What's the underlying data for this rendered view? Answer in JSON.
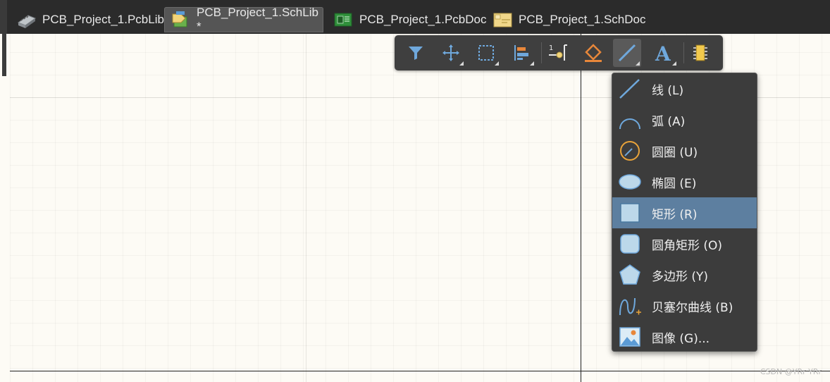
{
  "tabs": [
    {
      "label": "PCB_Project_1.PcbLib",
      "icon": "pcblib-icon",
      "active": false
    },
    {
      "label": "PCB_Project_1.SchLib *",
      "icon": "schlib-icon",
      "active": true
    },
    {
      "label": "PCB_Project_1.PcbDoc",
      "icon": "pcbdoc-icon",
      "active": false
    },
    {
      "label": "PCB_Project_1.SchDoc",
      "icon": "schdoc-icon",
      "active": false
    }
  ],
  "toolbar": {
    "buttons": [
      {
        "name": "filter-icon"
      },
      {
        "name": "move-icon"
      },
      {
        "name": "select-icon"
      },
      {
        "name": "align-icon"
      },
      {
        "name": "pin-icon"
      },
      {
        "name": "fill-icon"
      },
      {
        "name": "line-tool-icon",
        "active": true
      },
      {
        "name": "text-icon"
      },
      {
        "name": "component-icon"
      }
    ]
  },
  "menu": {
    "items": [
      {
        "label": "线 (L)",
        "icon": "line-icon"
      },
      {
        "label": "弧 (A)",
        "icon": "arc-icon"
      },
      {
        "label": "圆圈 (U)",
        "icon": "circle-icon"
      },
      {
        "label": "椭圆 (E)",
        "icon": "ellipse-icon"
      },
      {
        "label": "矩形 (R)",
        "icon": "rectangle-icon",
        "selected": true
      },
      {
        "label": "圆角矩形 (O)",
        "icon": "round-rectangle-icon"
      },
      {
        "label": "多边形 (Y)",
        "icon": "polygon-icon"
      },
      {
        "label": "贝塞尔曲线 (B)",
        "icon": "bezier-icon"
      },
      {
        "label": "图像 (G)...",
        "icon": "image-icon"
      }
    ]
  },
  "colors": {
    "selected_item": "#5d7fa0",
    "menu_bg": "#3c3c3c",
    "canvas_bg": "#fdfbf5",
    "accent_blue": "#5b9bd5",
    "accent_orange": "#e8873a"
  },
  "watermark": "CSDN @YRr YRr"
}
